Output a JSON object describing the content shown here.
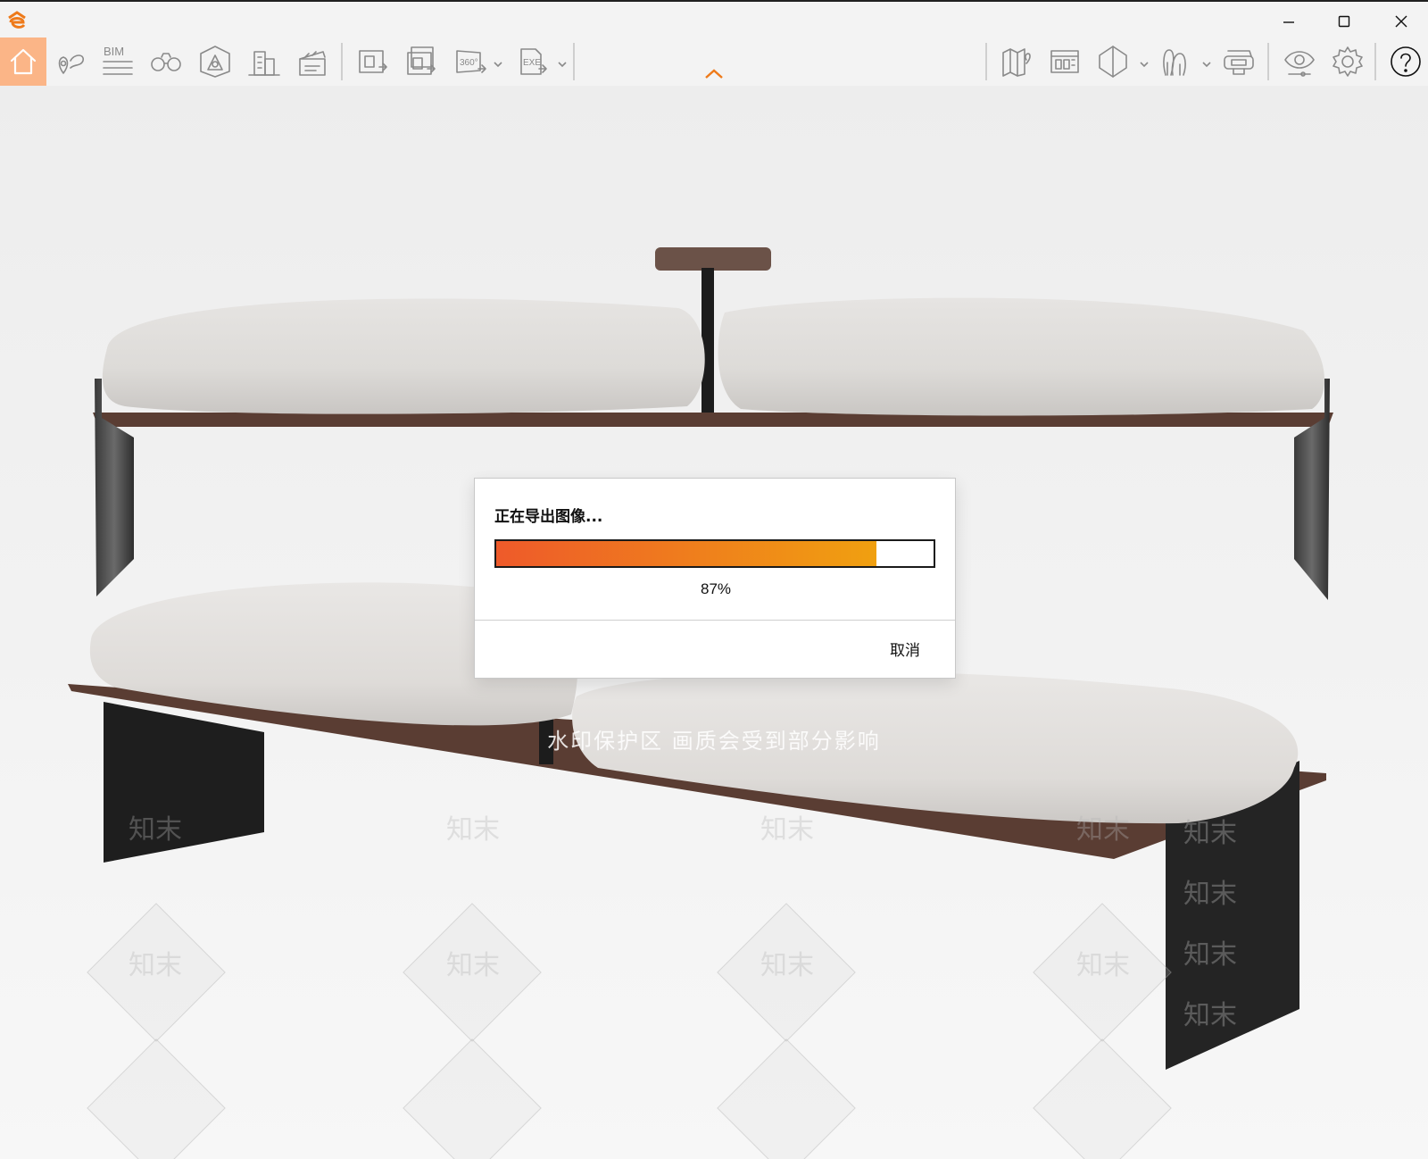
{
  "window": {
    "logo_icon": "app-logo-icon",
    "accent_color": "#ee7a1a"
  },
  "toolbar": {
    "bim_label": "BIM",
    "panorama_label": "360°",
    "exe_label": "EXE",
    "icons": [
      "home-icon",
      "location-pin-icon",
      "bim-icon",
      "binoculars-icon",
      "landscape-icon",
      "buildings-icon",
      "clapperboard-icon",
      "export-image-icon",
      "export-batch-icon",
      "export-panorama-icon",
      "export-exe-icon",
      "map-icon",
      "calculator-panel-icon",
      "cube-view-icon",
      "plants-icon",
      "vr-headset-icon",
      "eye-icon",
      "settings-icon",
      "help-icon"
    ]
  },
  "scene": {
    "watermark_text": "水印保护区  画质会受到部分影响",
    "watermark_brand": "知末"
  },
  "dialog": {
    "title": "正在导出图像...",
    "progress": 0.87,
    "progress_text": "87%",
    "cancel_label": "取消",
    "fill_start_color": "#ee5a2a",
    "fill_end_color": "#f0a010"
  }
}
